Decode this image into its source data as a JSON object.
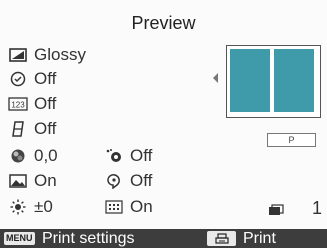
{
  "screen": {
    "title": "Preview",
    "settings_left": [
      {
        "icon": "paper-finish-icon",
        "value": "Glossy"
      },
      {
        "icon": "timer-icon",
        "value": "Off"
      },
      {
        "icon": "numbering-icon",
        "value": "Off"
      },
      {
        "icon": "border-icon",
        "value": "Off"
      },
      {
        "icon": "color-balance-icon",
        "value": "0,0"
      },
      {
        "icon": "image-optimize-icon",
        "value": "On"
      },
      {
        "icon": "brightness-icon",
        "value": "±0"
      }
    ],
    "settings_right": [
      {
        "icon": "red-eye-icon",
        "value": "Off"
      },
      {
        "icon": "face-correction-icon",
        "value": "Off"
      },
      {
        "icon": "grid-layout-icon",
        "value": "On"
      }
    ],
    "paper_label": "P",
    "copies": "1",
    "footer": {
      "menu_key": "MENU",
      "menu_label": "Print settings",
      "print_label": "Print"
    },
    "colors": {
      "preview_fill": "#3f9aaa",
      "footer_bg": "#3d3d3d"
    }
  }
}
